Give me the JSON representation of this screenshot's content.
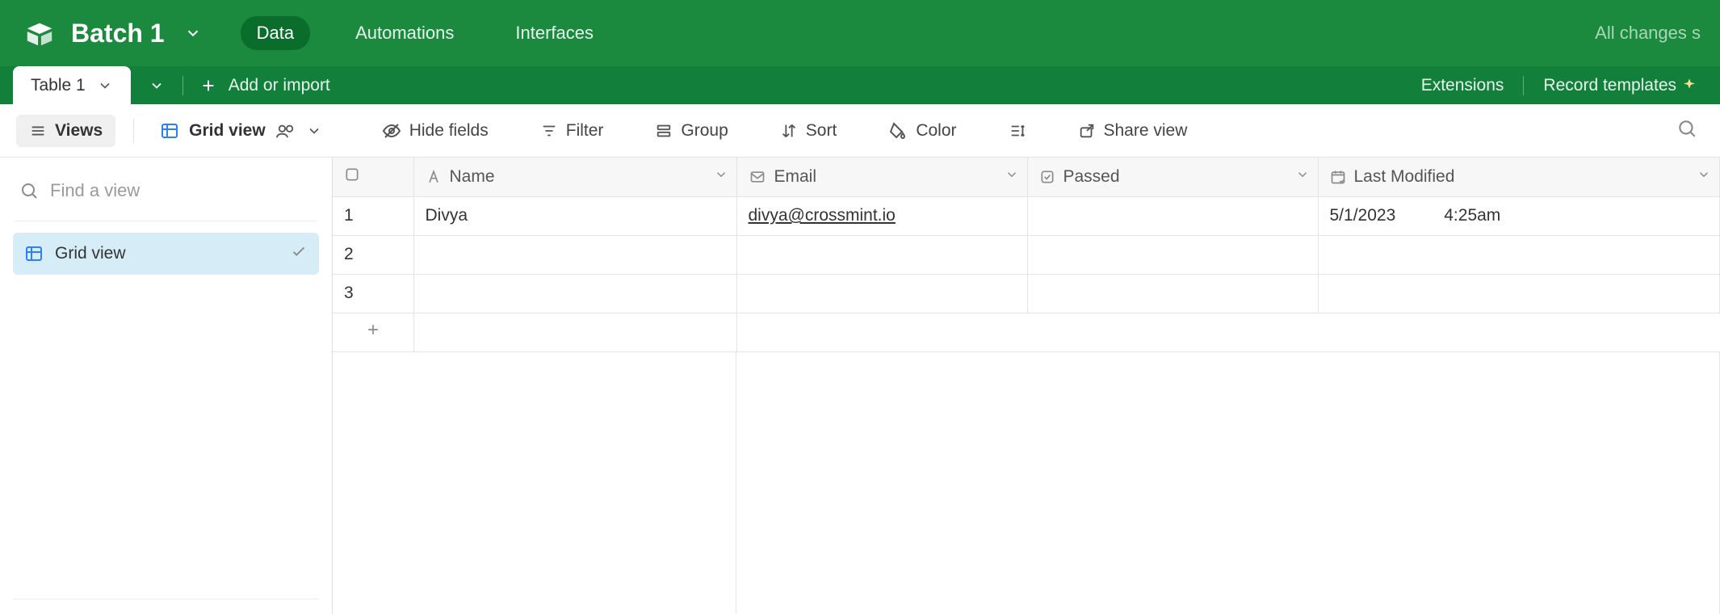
{
  "header": {
    "base_name": "Batch 1",
    "tabs": {
      "data": "Data",
      "automations": "Automations",
      "interfaces": "Interfaces"
    },
    "sync_status": "All changes s"
  },
  "tablesbar": {
    "active_table": "Table 1",
    "add_or_import": "Add or import",
    "extensions": "Extensions",
    "record_templates": "Record templates"
  },
  "toolbar": {
    "views": "Views",
    "grid_view": "Grid view",
    "hide_fields": "Hide fields",
    "filter": "Filter",
    "group": "Group",
    "sort": "Sort",
    "color": "Color",
    "share_view": "Share view"
  },
  "sidebar": {
    "find_placeholder": "Find a view",
    "views": [
      {
        "label": "Grid view",
        "selected": true
      }
    ]
  },
  "grid": {
    "columns": {
      "name": "Name",
      "email": "Email",
      "passed": "Passed",
      "last_modified": "Last Modified"
    },
    "rows": [
      {
        "num": "1",
        "name": "Divya",
        "email": "divya@crossmint.io",
        "passed": "",
        "modified_date": "5/1/2023",
        "modified_time": "4:25am"
      },
      {
        "num": "2",
        "name": "",
        "email": "",
        "passed": "",
        "modified_date": "",
        "modified_time": ""
      },
      {
        "num": "3",
        "name": "",
        "email": "",
        "passed": "",
        "modified_date": "",
        "modified_time": ""
      }
    ]
  }
}
